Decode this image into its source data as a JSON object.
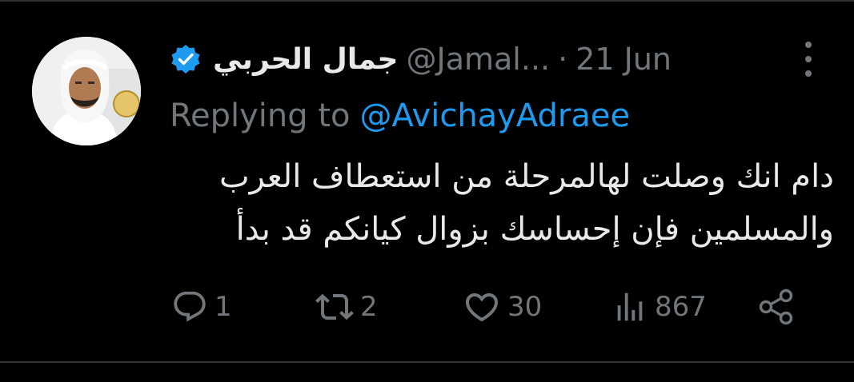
{
  "tweet": {
    "display_name": "جمال الحربي",
    "handle": "@Jamal...",
    "separator": "·",
    "date": "21 Jun",
    "reply_prefix": "Replying to",
    "reply_to": "@AvichayAdraee",
    "text_line1": "دام انك وصلت لهالمرحلة من استعطاف العرب",
    "text_line2": "والمسلمين فإن إحساسك بزوال كيانكم قد بدأ"
  },
  "actions": {
    "replies": "1",
    "retweets": "2",
    "likes": "30",
    "views": "867"
  },
  "icons": {
    "verified": "verified-badge-icon",
    "more": "more-options-icon",
    "reply": "reply-icon",
    "retweet": "retweet-icon",
    "like": "heart-icon",
    "views": "views-chart-icon",
    "share": "share-icon"
  },
  "colors": {
    "background": "#000000",
    "text": "#e7e9ea",
    "muted": "#71767b",
    "accent": "#1d9bf0"
  }
}
